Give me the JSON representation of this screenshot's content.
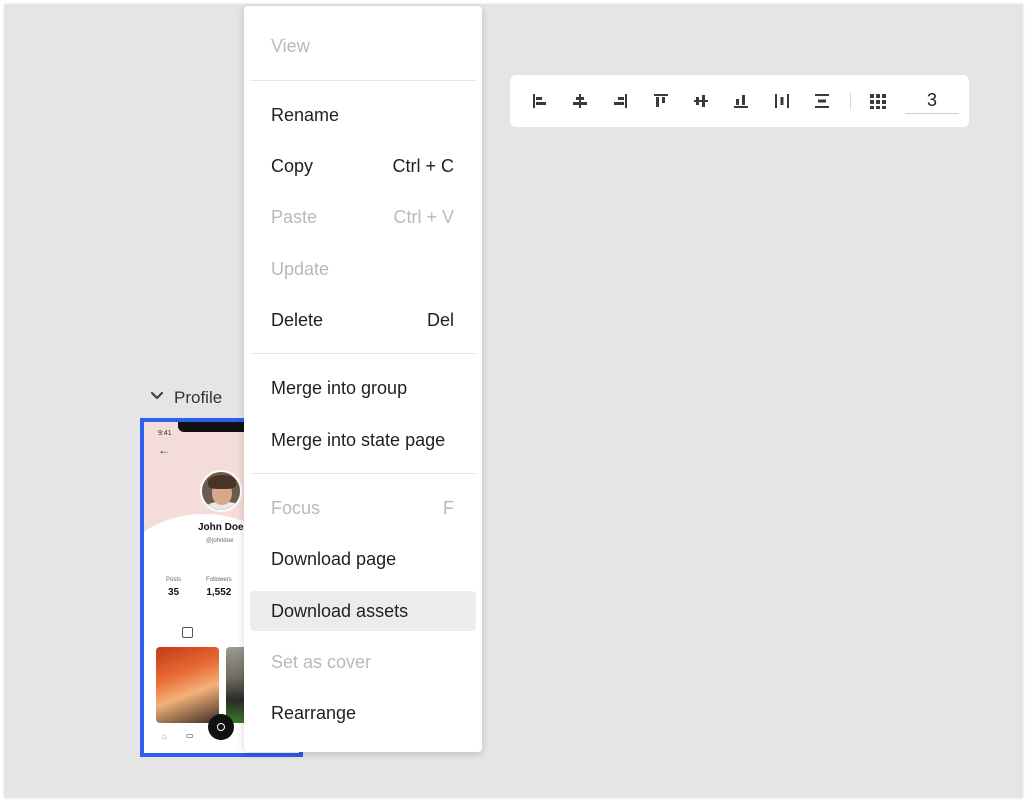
{
  "toolbar": {
    "buttons": [
      {
        "name": "align-left-icon"
      },
      {
        "name": "align-horizontal-center-icon"
      },
      {
        "name": "align-right-icon"
      },
      {
        "name": "align-top-icon"
      },
      {
        "name": "align-vertical-center-icon"
      },
      {
        "name": "align-bottom-icon"
      },
      {
        "name": "distribute-horizontal-icon"
      },
      {
        "name": "distribute-vertical-icon"
      },
      {
        "name": "grid-icon"
      }
    ],
    "grid_columns_value": "3"
  },
  "page": {
    "title": "Profile",
    "preview": {
      "status_time": "9:41",
      "name": "John Doe",
      "handle": "@johndoe",
      "stats": [
        {
          "label": "Posts",
          "value": "35"
        },
        {
          "label": "Followers",
          "value": "1,552"
        }
      ]
    }
  },
  "context_menu": {
    "items": [
      {
        "label": "View",
        "shortcut": "",
        "disabled": true
      },
      {
        "label": "Rename",
        "shortcut": "",
        "disabled": false
      },
      {
        "label": "Copy",
        "shortcut": "Ctrl + C",
        "disabled": false
      },
      {
        "label": "Paste",
        "shortcut": "Ctrl + V",
        "disabled": true
      },
      {
        "label": "Update",
        "shortcut": "",
        "disabled": true
      },
      {
        "label": "Delete",
        "shortcut": "Del",
        "disabled": false
      },
      {
        "label": "Merge into group",
        "shortcut": "",
        "disabled": false
      },
      {
        "label": "Merge into state page",
        "shortcut": "",
        "disabled": false
      },
      {
        "label": "Focus",
        "shortcut": "F",
        "disabled": true
      },
      {
        "label": "Download page",
        "shortcut": "",
        "disabled": false
      },
      {
        "label": "Download assets",
        "shortcut": "",
        "disabled": false,
        "hovered": true
      },
      {
        "label": "Set as cover",
        "shortcut": "",
        "disabled": true
      },
      {
        "label": "Rearrange",
        "shortcut": "",
        "disabled": false
      }
    ]
  },
  "colors": {
    "canvas_bg": "#e5e5e5",
    "selection_border": "#2f5ef0",
    "menu_hover_bg": "#ececec",
    "disabled_text": "#b9b9b9",
    "icon_color": "#3a3a3a"
  }
}
